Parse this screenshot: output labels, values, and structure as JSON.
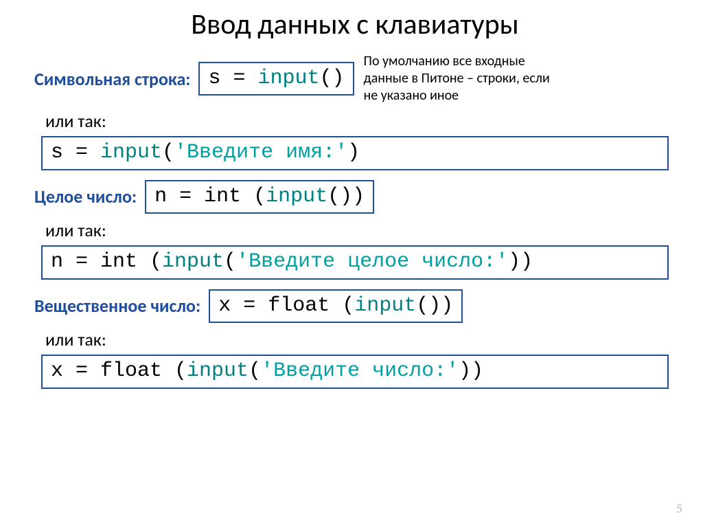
{
  "title": "Ввод данных с клавиатуры",
  "labels": {
    "string": "Символьная строка:",
    "or": "или так:",
    "int": "Целое число:",
    "float": "Вещественное число:"
  },
  "note": "По умолчанию все входные данные в Питоне – строки, если не указано иное",
  "code": {
    "s1_a": "s = ",
    "s1_b": "input",
    "s1_c": "()",
    "s2_a": "s = ",
    "s2_b": "input",
    "s2_c": "(",
    "s2_d": "'Введите имя:'",
    "s2_e": ")",
    "n1_a": "n = int",
    "n1_b": " (",
    "n1_c": "input",
    "n1_d": "())",
    "n2_a": "n = int (",
    "n2_b": "input",
    "n2_c": "(",
    "n2_d": "'Введите целое число:'",
    "n2_e": "))",
    "x1_a": "x = float",
    "x1_b": " (",
    "x1_c": "input",
    "x1_d": "())",
    "x2_a": "x = float (",
    "x2_b": "input",
    "x2_c": "(",
    "x2_d": "'Введите число:'",
    "x2_e": "))"
  },
  "page": "5"
}
